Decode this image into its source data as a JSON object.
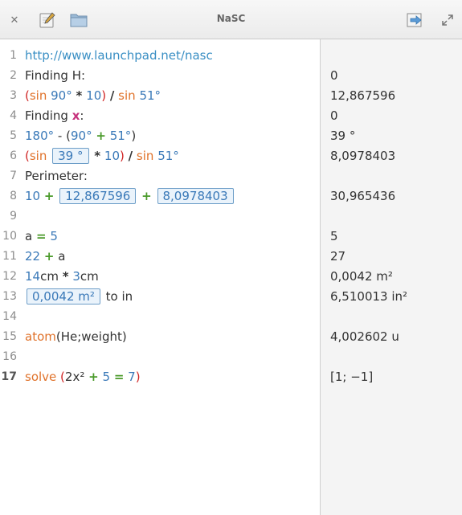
{
  "window": {
    "title": "NaSC"
  },
  "toolbar": {
    "close_glyph": "✕",
    "close_icon": "close-icon",
    "edit_icon": "pencil-icon",
    "folder_icon": "folder-icon",
    "export_icon": "export-arrow-icon",
    "maximize_icon": "maximize-icon"
  },
  "lines": [
    {
      "n": "1",
      "result": ""
    },
    {
      "n": "2",
      "result": "0"
    },
    {
      "n": "3",
      "result": "12,867596"
    },
    {
      "n": "4",
      "result": "0"
    },
    {
      "n": "5",
      "result": "39 °"
    },
    {
      "n": "6",
      "result": "8,0978403"
    },
    {
      "n": "7",
      "result": ""
    },
    {
      "n": "8",
      "result": "30,965436"
    },
    {
      "n": "9",
      "result": ""
    },
    {
      "n": "10",
      "result": "5"
    },
    {
      "n": "11",
      "result": "27"
    },
    {
      "n": "12",
      "result": "0,0042 m²"
    },
    {
      "n": "13",
      "result": "6,510013 in²"
    },
    {
      "n": "14",
      "result": ""
    },
    {
      "n": "15",
      "result": "4,002602 u"
    },
    {
      "n": "16",
      "result": ""
    },
    {
      "n": "17",
      "result": "[1; −1]"
    }
  ],
  "code": {
    "l1": {
      "url": "http://www.launchpad.net/nasc"
    },
    "l2": {
      "text": "Finding H:"
    },
    "l3": {
      "p1": "(",
      "sin1": "sin",
      "v1": "90°",
      "mul": "*",
      "v2": "10",
      "p2": ")",
      "div": "/",
      "sin2": "sin",
      "v3": "51°"
    },
    "l4": {
      "text": "Finding ",
      "var": "x",
      "colon": ":"
    },
    "l5": {
      "v1": "180°",
      "minus": "-",
      "p1": "(",
      "v2": "90°",
      "plus": "+",
      "v3": "51°",
      "p2": ")"
    },
    "l6": {
      "p1": "(",
      "sin1": "sin",
      "box": "39 °",
      "mul": "*",
      "v2": "10",
      "p2": ")",
      "div": "/",
      "sin2": "sin",
      "v3": "51°"
    },
    "l7": {
      "text": "Perimeter:"
    },
    "l8": {
      "v1": "10",
      "plus1": "+",
      "box1": "12,867596",
      "plus2": "+",
      "box2": "8,0978403"
    },
    "l10": {
      "a": "a",
      "eq": "=",
      "v": "5"
    },
    "l11": {
      "v": "22",
      "plus": "+",
      "a": "a"
    },
    "l12": {
      "v1": "14",
      "u1": "cm",
      "mul": "*",
      "v2": "3",
      "u2": "cm"
    },
    "l13": {
      "box": "0,0042 m²",
      "rest": "to in"
    },
    "l15": {
      "fn": "atom",
      "args": "(He;weight)"
    },
    "l17": {
      "fn": "solve",
      "p1": "(",
      "v1": "2x²",
      "plus": "+",
      "v2": "5",
      "eq": "=",
      "v3": "7",
      "p2": ")"
    }
  }
}
